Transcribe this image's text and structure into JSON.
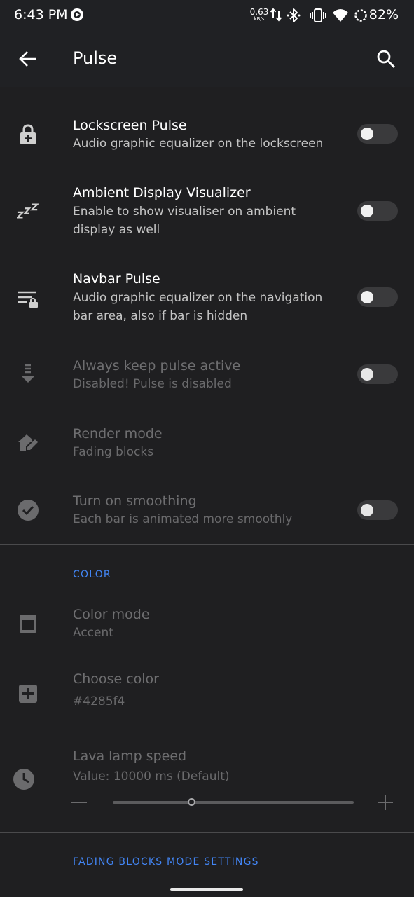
{
  "status_bar": {
    "time": "6:43 PM",
    "net_speed_value": "0.63",
    "net_speed_unit": "kB/s",
    "battery": "82%",
    "icons": [
      "media-playing-icon",
      "data-arrows-icon",
      "bluetooth-icon",
      "vibrate-icon",
      "wifi-icon",
      "battery-saver-ring-icon"
    ]
  },
  "toolbar": {
    "title": "Pulse",
    "back_icon": "arrow-back-icon",
    "search_icon": "search-icon"
  },
  "preferences": [
    {
      "title": "Lockscreen Pulse",
      "summary": "Audio graphic equalizer on the lockscreen",
      "icon": "lock-plus-icon",
      "switch": false,
      "enabled": true
    },
    {
      "title": "Ambient Display Visualizer",
      "summary": "Enable to show visualiser on ambient display as well",
      "icon": "sleep-zzz-icon",
      "switch": false,
      "enabled": true
    },
    {
      "title": "Navbar Pulse",
      "summary": "Audio graphic equalizer on the navigation bar area, also if bar is hidden",
      "icon": "navbar-lock-icon",
      "switch": false,
      "enabled": true
    },
    {
      "title": "Always keep pulse active",
      "summary": "Disabled! Pulse is disabled",
      "icon": "arrow-down-lines-icon",
      "switch": false,
      "enabled": false
    },
    {
      "title": "Render mode",
      "summary": "Fading blocks",
      "icon": "home-edit-icon",
      "enabled": false
    },
    {
      "title": "Turn on smoothing",
      "summary": "Each bar is animated more smoothly",
      "icon": "check-circle-icon",
      "switch": false,
      "enabled": false
    }
  ],
  "color_section": {
    "header": "COLOR",
    "color_mode": {
      "title": "Color mode",
      "summary": "Accent",
      "icon": "color-window-icon"
    },
    "choose_color": {
      "title": "Choose color",
      "summary": "#4285f4",
      "icon": "plus-box-icon"
    },
    "lava_lamp": {
      "title": "Lava lamp speed",
      "summary": "Value: 10000 ms (Default)",
      "icon": "clock-icon"
    }
  },
  "fading_section": {
    "header": "FADING BLOCKS MODE SETTINGS"
  },
  "colors": {
    "background": "#202124",
    "accent": "#4285f4",
    "disabled_text": "#6e6e70"
  }
}
